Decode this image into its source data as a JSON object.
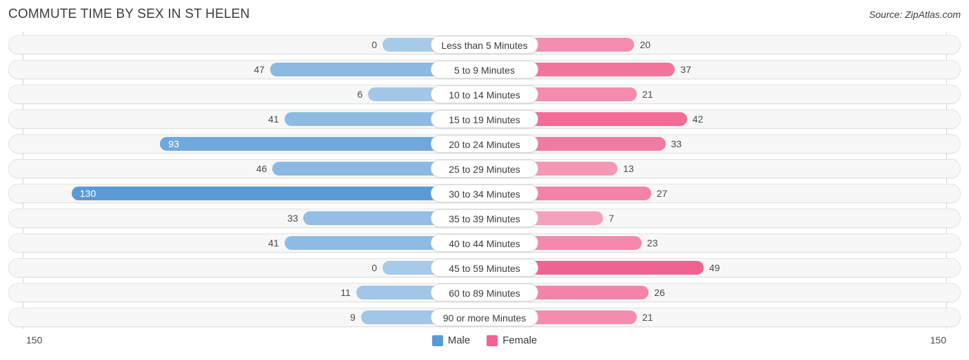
{
  "header": {
    "title": "COMMUTE TIME BY SEX IN ST HELEN",
    "source": "Source: ZipAtlas.com"
  },
  "axis": {
    "left_label": "150",
    "right_label": "150"
  },
  "legend": {
    "items": [
      {
        "label": "Male",
        "color": "#5b9bd5",
        "icon": "square-swatch"
      },
      {
        "label": "Female",
        "color": "#f0628f",
        "icon": "square-swatch"
      }
    ]
  },
  "colors": {
    "male_base": "#5b9bd5",
    "female_base": "#f0628f",
    "row_background": "#f7f7f7",
    "row_border": "#e3e3e3",
    "text": "#3c3c3c"
  },
  "chart_data": {
    "type": "bar",
    "orientation": "horizontal-diverging",
    "title": "COMMUTE TIME BY SEX IN ST HELEN",
    "xlabel": "",
    "ylabel": "",
    "xlim": [
      -150,
      150
    ],
    "axis_max": 150,
    "grid": false,
    "legend_position": "bottom-center",
    "categories": [
      "Less than 5 Minutes",
      "5 to 9 Minutes",
      "10 to 14 Minutes",
      "15 to 19 Minutes",
      "20 to 24 Minutes",
      "25 to 29 Minutes",
      "30 to 34 Minutes",
      "35 to 39 Minutes",
      "40 to 44 Minutes",
      "45 to 59 Minutes",
      "60 to 89 Minutes",
      "90 or more Minutes"
    ],
    "series": [
      {
        "name": "Male",
        "side": "left",
        "values": [
          0,
          47,
          6,
          41,
          93,
          46,
          130,
          33,
          41,
          0,
          11,
          9
        ]
      },
      {
        "name": "Female",
        "side": "right",
        "values": [
          20,
          37,
          21,
          42,
          33,
          13,
          27,
          7,
          23,
          49,
          26,
          21
        ]
      }
    ]
  }
}
